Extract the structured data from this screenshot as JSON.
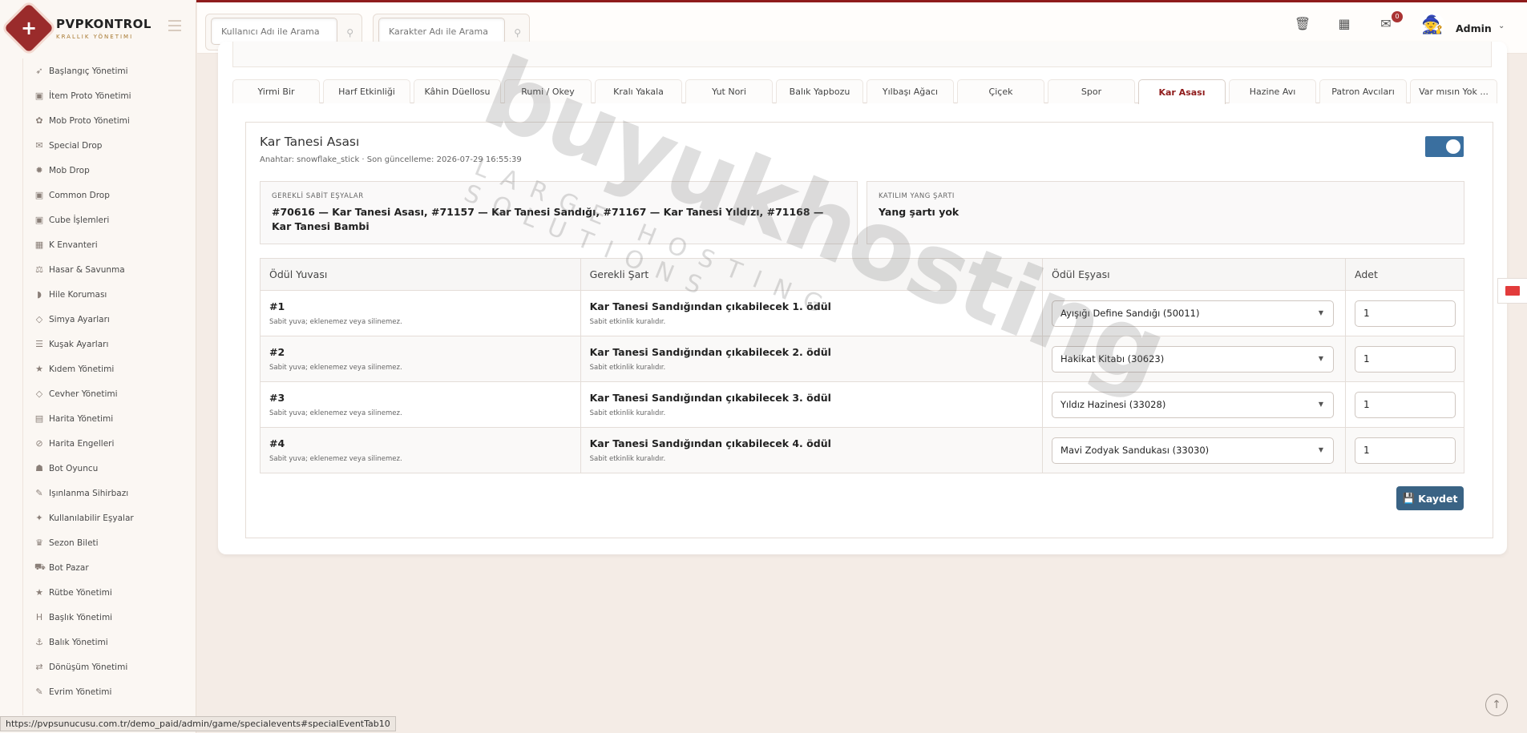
{
  "brand": {
    "name": "PVPKONTROL",
    "tagline": "KRALLIK YÖNETIMI"
  },
  "search": {
    "user_placeholder": "Kullanıcı Adı ile Arama",
    "char_placeholder": "Karakter Adı ile Arama"
  },
  "header": {
    "admin_name": "Admin",
    "mail_badge": "0"
  },
  "sidebar": {
    "items": [
      {
        "label": "Başlangıç Yönetimi",
        "icon": "rocket-icon",
        "glyph": "➶"
      },
      {
        "label": "İtem Proto Yönetimi",
        "icon": "box-icon",
        "glyph": "▣"
      },
      {
        "label": "Mob Proto Yönetimi",
        "icon": "paw-icon",
        "glyph": "✿"
      },
      {
        "label": "Special Drop",
        "icon": "gift-icon",
        "glyph": "✉"
      },
      {
        "label": "Mob Drop",
        "icon": "bug-icon",
        "glyph": "✹"
      },
      {
        "label": "Common Drop",
        "icon": "box-icon",
        "glyph": "▣"
      },
      {
        "label": "Cube İşlemleri",
        "icon": "cube-icon",
        "glyph": "▣"
      },
      {
        "label": "K Envanteri",
        "icon": "grid-icon",
        "glyph": "▦"
      },
      {
        "label": "Hasar & Savunma",
        "icon": "scale-icon",
        "glyph": "⚖"
      },
      {
        "label": "Hile Koruması",
        "icon": "shield-icon",
        "glyph": "◗"
      },
      {
        "label": "Simya Ayarları",
        "icon": "gem-icon",
        "glyph": "◇"
      },
      {
        "label": "Kuşak Ayarları",
        "icon": "sliders-icon",
        "glyph": "☰"
      },
      {
        "label": "Kıdem Yönetimi",
        "icon": "star-icon",
        "glyph": "★"
      },
      {
        "label": "Cevher Yönetimi",
        "icon": "gem-icon",
        "glyph": "◇"
      },
      {
        "label": "Harita Yönetimi",
        "icon": "map-icon",
        "glyph": "▤"
      },
      {
        "label": "Harita Engelleri",
        "icon": "ban-icon",
        "glyph": "⊘"
      },
      {
        "label": "Bot Oyuncu",
        "icon": "robot-icon",
        "glyph": "☗"
      },
      {
        "label": "Işınlanma Sihirbazı",
        "icon": "wand-icon",
        "glyph": "✎"
      },
      {
        "label": "Kullanılabilir Eşyalar",
        "icon": "magic-icon",
        "glyph": "✦"
      },
      {
        "label": "Sezon Bileti",
        "icon": "trophy-icon",
        "glyph": "♛"
      },
      {
        "label": "Bot Pazar",
        "icon": "cart-icon",
        "glyph": "⛟"
      },
      {
        "label": "Rütbe Yönetimi",
        "icon": "star-icon",
        "glyph": "★"
      },
      {
        "label": "Başlık Yönetimi",
        "icon": "heading-icon",
        "glyph": "H"
      },
      {
        "label": "Balık Yönetimi",
        "icon": "anchor-icon",
        "glyph": "⚓"
      },
      {
        "label": "Dönüşüm Yönetimi",
        "icon": "shuffle-icon",
        "glyph": "⇄"
      },
      {
        "label": "Evrim Yönetimi",
        "icon": "wand-icon",
        "glyph": "✎"
      }
    ]
  },
  "tabs": [
    {
      "label": "Yirmi Bir",
      "active": false
    },
    {
      "label": "Harf Etkinliği",
      "active": false
    },
    {
      "label": "Kâhin Düellosu",
      "active": false
    },
    {
      "label": "Rumi / Okey",
      "active": false
    },
    {
      "label": "Kralı Yakala",
      "active": false
    },
    {
      "label": "Yut Nori",
      "active": false
    },
    {
      "label": "Balık Yapbozu",
      "active": false
    },
    {
      "label": "Yılbaşı Ağacı",
      "active": false
    },
    {
      "label": "Çiçek",
      "active": false
    },
    {
      "label": "Spor",
      "active": false
    },
    {
      "label": "Kar Asası",
      "active": true
    },
    {
      "label": "Hazine Avı",
      "active": false
    },
    {
      "label": "Patron Avcıları",
      "active": false
    },
    {
      "label": "Var mısın Yok ...",
      "active": false
    }
  ],
  "event": {
    "title": "Kar Tanesi Asası",
    "subtitle": "Anahtar: snowflake_stick · Son güncelleme: 2026-07-29 16:55:39",
    "enabled": true
  },
  "required_items": {
    "label": "GEREKLİ SABİT EŞYALAR",
    "value": "#70616 — Kar Tanesi Asası, #71157 — Kar Tanesi Sandığı, #71167 — Kar Tanesi Yıldızı, #71168 — Kar Tanesi Bambi"
  },
  "yang_condition": {
    "label": "KATILIM YANG ŞARTI",
    "value": "Yang şartı yok"
  },
  "table": {
    "headers": [
      "Ödül Yuvası",
      "Gerekli Şart",
      "Ödül Eşyası",
      "Adet"
    ],
    "rows": [
      {
        "slot": "#1",
        "slot_note": "Sabit yuva; eklenemez veya silinemez.",
        "condition": "Kar Tanesi Sandığından çıkabilecek 1. ödül",
        "condition_note": "Sabit etkinlik kuralıdır.",
        "item": "Ayışığı Define Sandığı (50011)",
        "qty": "1"
      },
      {
        "slot": "#2",
        "slot_note": "Sabit yuva; eklenemez veya silinemez.",
        "condition": "Kar Tanesi Sandığından çıkabilecek 2. ödül",
        "condition_note": "Sabit etkinlik kuralıdır.",
        "item": "Hakikat Kitabı (30623)",
        "qty": "1"
      },
      {
        "slot": "#3",
        "slot_note": "Sabit yuva; eklenemez veya silinemez.",
        "condition": "Kar Tanesi Sandığından çıkabilecek 3. ödül",
        "condition_note": "Sabit etkinlik kuralıdır.",
        "item": "Yıldız Hazinesi (33028)",
        "qty": "1"
      },
      {
        "slot": "#4",
        "slot_note": "Sabit yuva; eklenemez veya silinemez.",
        "condition": "Kar Tanesi Sandığından çıkabilecek 4. ödül",
        "condition_note": "Sabit etkinlik kuralıdır.",
        "item": "Mavi Zodyak Sandukası (33030)",
        "qty": "1"
      }
    ]
  },
  "save_label": "Kaydet",
  "watermark": {
    "main": "buyukhosting",
    "sub": "LARGE HOSTING SOLUTIONS"
  },
  "status_url": "https://pvpsunucusu.com.tr/demo_paid/admin/game/specialevents#specialEventTab10",
  "colors": {
    "accent": "#8f1b1b",
    "primary_button": "#3a6384",
    "toggle_on": "#3a6f9f"
  }
}
